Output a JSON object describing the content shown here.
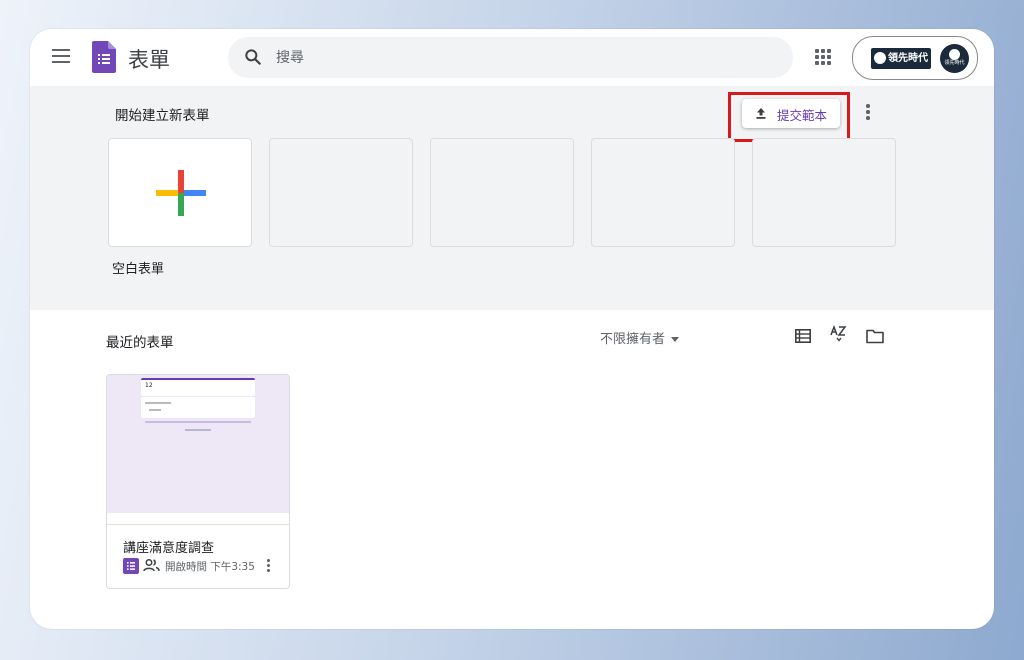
{
  "app": {
    "title": "表單"
  },
  "search": {
    "placeholder": "搜尋"
  },
  "account": {
    "brand": "領先時代",
    "avatar_text": "領先時代"
  },
  "templates": {
    "section_title": "開始建立新表單",
    "submit_label": "提交範本",
    "blank_label": "空白表單"
  },
  "recent": {
    "section_title": "最近的表單",
    "owner_filter": "不限擁有者",
    "documents": [
      {
        "thumbnail_number": "12",
        "title": "講座滿意度調查",
        "meta": "開啟時間 下午3:35"
      }
    ]
  },
  "colors": {
    "accent": "#673ab7",
    "highlight": "#d7191e",
    "template_bg": "#f1f3f4"
  },
  "icons": [
    "hamburger-icon",
    "forms-logo-icon",
    "search-icon",
    "apps-grid-icon",
    "upload-icon",
    "more-vert-icon",
    "plus-icon",
    "list-view-icon",
    "sort-az-icon",
    "folder-icon",
    "shared-people-icon"
  ]
}
